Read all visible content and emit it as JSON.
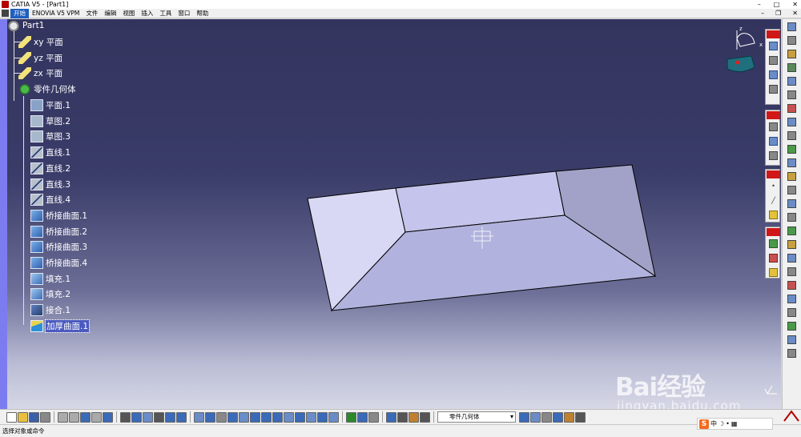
{
  "window": {
    "title": "CATIA V5 - [Part1]",
    "minimize": "–",
    "maximize": "□",
    "close": "✕"
  },
  "menu": {
    "items": [
      "开始",
      "ENOVIA V5 VPM",
      "文件",
      "编辑",
      "视图",
      "插入",
      "工具",
      "窗口",
      "帮助"
    ],
    "mdi_minimize": "–",
    "mdi_restore": "❐",
    "mdi_close": "✕"
  },
  "tree": {
    "root": "Part1",
    "planes": [
      "xy 平面",
      "yz 平面",
      "zx 平面"
    ],
    "body": "零件几何体",
    "features": [
      {
        "label": "平面.1",
        "icon": "plane-feature-icon"
      },
      {
        "label": "草图.2",
        "icon": "sketch-icon"
      },
      {
        "label": "草图.3",
        "icon": "sketch-icon"
      },
      {
        "label": "直线.1",
        "icon": "line-icon"
      },
      {
        "label": "直线.2",
        "icon": "line-icon"
      },
      {
        "label": "直线.3",
        "icon": "line-icon"
      },
      {
        "label": "直线.4",
        "icon": "line-icon"
      },
      {
        "label": "桥接曲面.1",
        "icon": "blend-surface-icon"
      },
      {
        "label": "桥接曲面.2",
        "icon": "blend-surface-icon"
      },
      {
        "label": "桥接曲面.3",
        "icon": "blend-surface-icon"
      },
      {
        "label": "桥接曲面.4",
        "icon": "blend-surface-icon"
      },
      {
        "label": "填充.1",
        "icon": "fill-icon"
      },
      {
        "label": "填充.2",
        "icon": "fill-icon"
      },
      {
        "label": "接合.1",
        "icon": "join-icon"
      },
      {
        "label": "加厚曲面.1",
        "icon": "thick-surface-icon"
      }
    ],
    "selected": "加厚曲面.1"
  },
  "compass": {
    "axis_z": "z",
    "axis_x": "x"
  },
  "toolbar": {
    "current_body": "零件几何体"
  },
  "status": {
    "prompt": "选择对象或命令",
    "command_placeholder": "",
    "ime": "S"
  },
  "watermark": {
    "brand": "Bai经验",
    "url": "jingyan.baidu.com"
  },
  "colors": {
    "bg_top": "#33345e",
    "bg_bottom": "#d6d8e6",
    "face_light": "#d8d8f4",
    "face_mid": "#b2b2de",
    "face_dark": "#9e9ec8",
    "selection": "#4a5abf"
  }
}
